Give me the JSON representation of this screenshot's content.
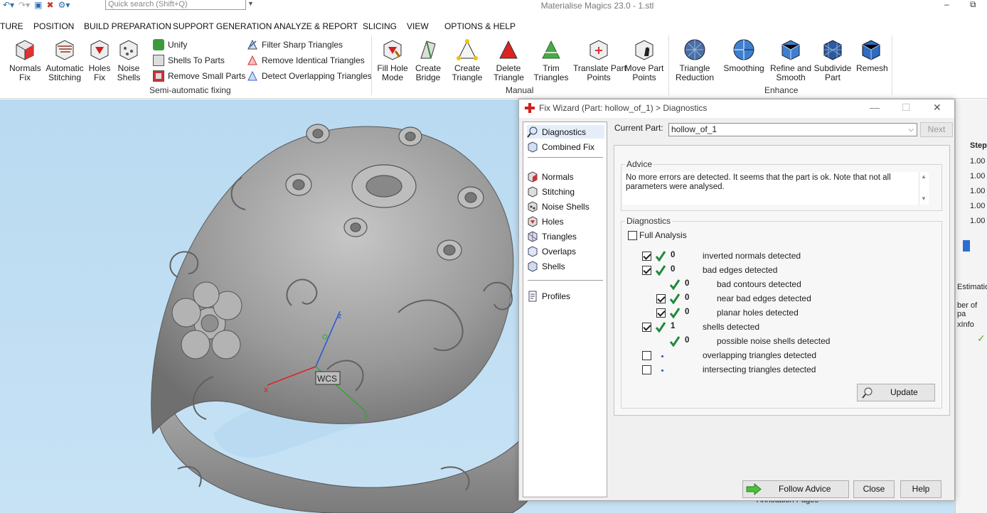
{
  "titlebar": {
    "quick_search_placeholder": "Quick search (Shift+Q)",
    "app_title": "Materialise Magics 23.0 - 1.stl",
    "minimize": "–",
    "restore": "⧉"
  },
  "menu": {
    "tabs": [
      "TURE",
      "POSITION",
      "BUILD PREPARATION",
      "SUPPORT GENERATION",
      "ANALYZE & REPORT",
      "SLICING",
      "VIEW",
      "OPTIONS & HELP"
    ]
  },
  "ribbon": {
    "big_buttons": [
      {
        "label": "Normals\nFix",
        "icon": "normals-fix-icon"
      },
      {
        "label": "Automatic\nStitching",
        "icon": "stitching-icon"
      },
      {
        "label": "Holes\nFix",
        "icon": "holes-fix-icon"
      },
      {
        "label": "Noise\nShells",
        "icon": "noise-shells-icon"
      },
      {
        "label": "Fill Hole\nMode",
        "icon": "fill-hole-icon"
      },
      {
        "label": "Create\nBridge",
        "icon": "create-bridge-icon"
      },
      {
        "label": "Create\nTriangle",
        "icon": "create-triangle-icon"
      },
      {
        "label": "Delete\nTriangle",
        "icon": "delete-triangle-icon"
      },
      {
        "label": "Trim\nTriangles",
        "icon": "trim-triangles-icon"
      },
      {
        "label": "Translate Part\nPoints",
        "icon": "translate-points-icon"
      },
      {
        "label": "Move Part\nPoints",
        "icon": "move-points-icon"
      },
      {
        "label": "Triangle\nReduction",
        "icon": "triangle-reduction-icon"
      },
      {
        "label": "Smoothing",
        "icon": "smoothing-icon"
      },
      {
        "label": "Refine and\nSmooth",
        "icon": "refine-smooth-icon"
      },
      {
        "label": "Subdivide\nPart",
        "icon": "subdivide-icon"
      },
      {
        "label": "Remesh",
        "icon": "remesh-icon"
      }
    ],
    "small_buttons": {
      "unify": "Unify",
      "shells_to_parts": "Shells To Parts",
      "remove_small_parts": "Remove Small Parts",
      "filter_sharp": "Filter Sharp Triangles",
      "remove_identical": "Remove Identical Triangles",
      "detect_overlapping": "Detect Overlapping Triangles"
    },
    "groups": {
      "semi_auto": "Semi-automatic fixing",
      "manual": "Manual",
      "enhance": "Enhance"
    }
  },
  "viewport": {
    "axis_x": "x",
    "axis_y": "y",
    "axis_z": "z",
    "wcs": "WCS",
    "colors": {
      "bg_top": "#b9daf1",
      "model": "#9a9a9a"
    }
  },
  "dialog": {
    "title": "Fix Wizard (Part: hollow_of_1) > Diagnostics",
    "close_x": "✕",
    "nav": {
      "diagnostics": "Diagnostics",
      "combined_fix": "Combined Fix",
      "normals": "Normals",
      "stitching": "Stitching",
      "noise_shells": "Noise Shells",
      "holes": "Holes",
      "triangles": "Triangles",
      "overlaps": "Overlaps",
      "shells": "Shells",
      "profiles": "Profiles"
    },
    "current_part_label": "Current Part:",
    "current_part_value": "hollow_of_1",
    "next_label": "Next",
    "advice_title": "Advice",
    "advice_text": "No more errors are detected. It seems that the part is ok. Note that not all parameters were analysed.",
    "diagnostics_title": "Diagnostics",
    "full_analysis_label": "Full Analysis",
    "rows": {
      "inverted_normals": {
        "count": "0",
        "label": "inverted normals detected"
      },
      "bad_edges": {
        "count": "0",
        "label": "bad edges detected"
      },
      "bad_contours": {
        "count": "0",
        "label": "bad contours detected"
      },
      "near_bad_edges": {
        "count": "0",
        "label": "near bad edges detected"
      },
      "planar_holes": {
        "count": "0",
        "label": "planar holes detected"
      },
      "shells": {
        "count": "1",
        "label": "shells detected"
      },
      "noise_shells": {
        "count": "0",
        "label": "possible noise shells detected"
      },
      "overlapping": {
        "label": "overlapping triangles detected"
      },
      "intersecting": {
        "label": "intersecting triangles detected"
      }
    },
    "update_label": "Update",
    "follow_advice_label": "Follow Advice",
    "close_label": "Close",
    "help_label": "Help"
  },
  "right_panel": {
    "header": "Step",
    "values": [
      "1.00",
      "1.00",
      "1.00",
      "1.00",
      "1.00"
    ],
    "estimation": "Estimatio",
    "number_of_parts": "ber of pa",
    "info": "xInfo",
    "annotation_pages": "Annotation Pages"
  }
}
